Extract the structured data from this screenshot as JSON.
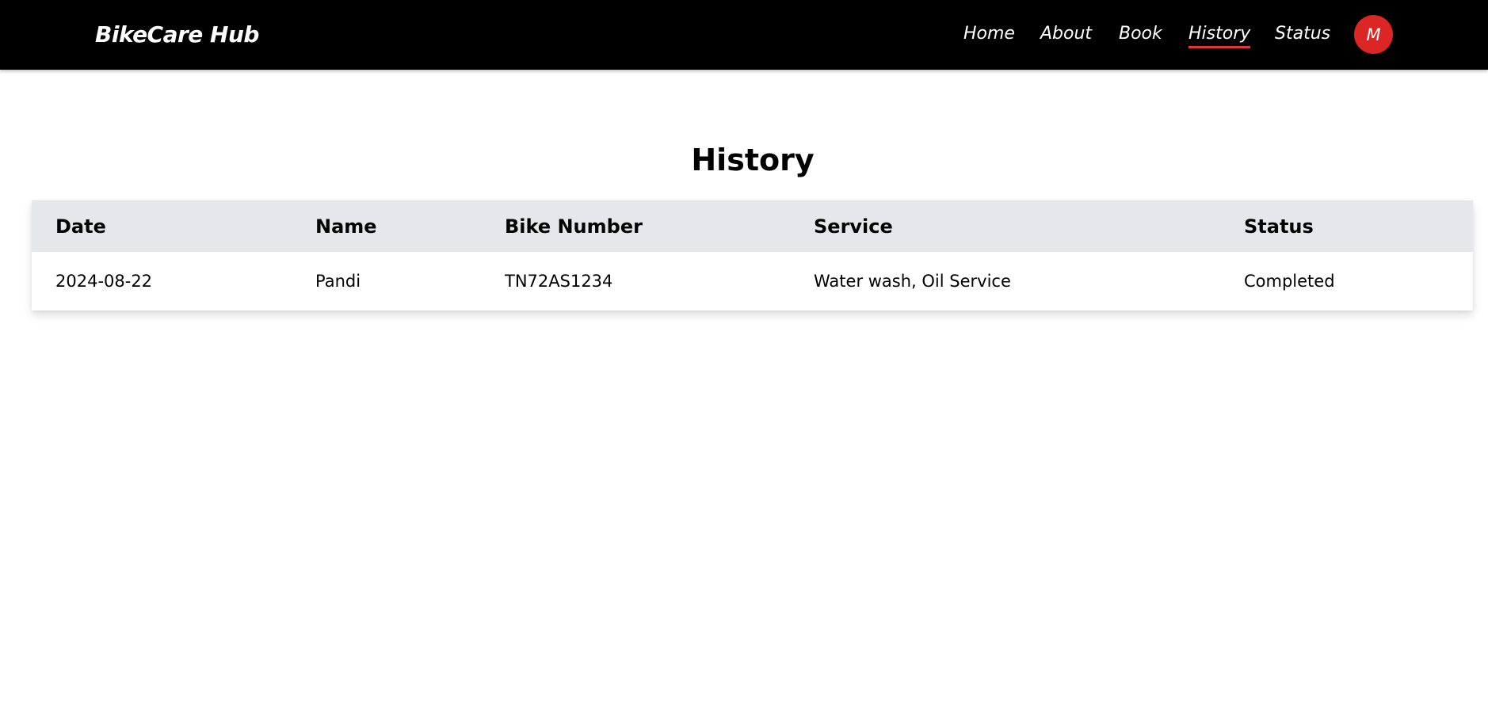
{
  "app": {
    "brand": "BikeCare Hub"
  },
  "nav": {
    "items": [
      {
        "label": "Home"
      },
      {
        "label": "About"
      },
      {
        "label": "Book"
      },
      {
        "label": "History",
        "active": true
      },
      {
        "label": "Status"
      }
    ],
    "avatar_initial": "M",
    "avatar_color": "#dc2626",
    "active_underline_color": "#e0383e"
  },
  "page": {
    "title": "History"
  },
  "history_table": {
    "columns": [
      "Date",
      "Name",
      "Bike Number",
      "Service",
      "Status"
    ],
    "rows": [
      {
        "date": "2024-08-22",
        "name": "Pandi",
        "bike_number": "TN72AS1234",
        "service": "Water wash, Oil Service",
        "status": "Completed"
      }
    ]
  },
  "colors": {
    "navbar_bg": "#000000",
    "table_header_bg": "#e5e7eb"
  }
}
